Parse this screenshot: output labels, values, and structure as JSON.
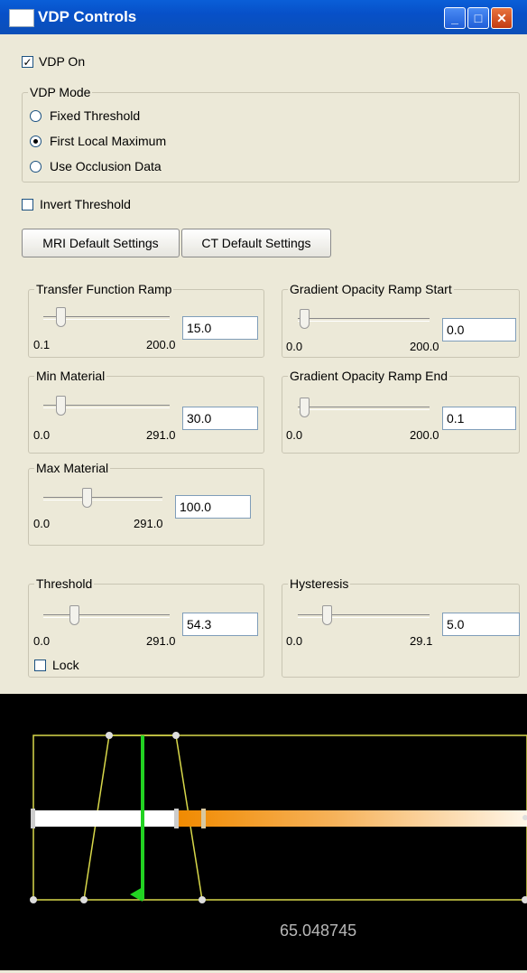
{
  "window": {
    "title": "VDP Controls"
  },
  "vdp_on": {
    "label": "VDP On",
    "checked": true
  },
  "vdp_mode": {
    "title": "VDP Mode",
    "options": [
      "Fixed Threshold",
      "First Local Maximum",
      "Use Occlusion Data"
    ],
    "selected": "First Local Maximum"
  },
  "invert_threshold": {
    "label": "Invert Threshold",
    "checked": false
  },
  "buttons": {
    "mri": "MRI Default Settings",
    "ct": "CT Default Settings"
  },
  "sliders": {
    "transfer": {
      "title": "Transfer Function Ramp",
      "value": "15.0",
      "min": "0.1",
      "max": "200.0"
    },
    "grad_start": {
      "title": "Gradient Opacity Ramp Start",
      "value": "0.0",
      "min": "0.0",
      "max": "200.0"
    },
    "min_material": {
      "title": "Min Material",
      "value": "30.0",
      "min": "0.0",
      "max": "291.0"
    },
    "grad_end": {
      "title": "Gradient Opacity Ramp End",
      "value": "0.1",
      "min": "0.0",
      "max": "200.0"
    },
    "max_material": {
      "title": "Max Material",
      "value": "100.0",
      "min": "0.0",
      "max": "291.0"
    },
    "threshold": {
      "title": "Threshold",
      "value": "54.3",
      "min": "0.0",
      "max": "291.0"
    },
    "hysteresis": {
      "title": "Hysteresis",
      "value": "5.0",
      "min": "0.0",
      "max": "29.1"
    }
  },
  "lock": {
    "label": "Lock",
    "checked": false
  },
  "transfer_function": {
    "value_readout": "65.048745"
  }
}
